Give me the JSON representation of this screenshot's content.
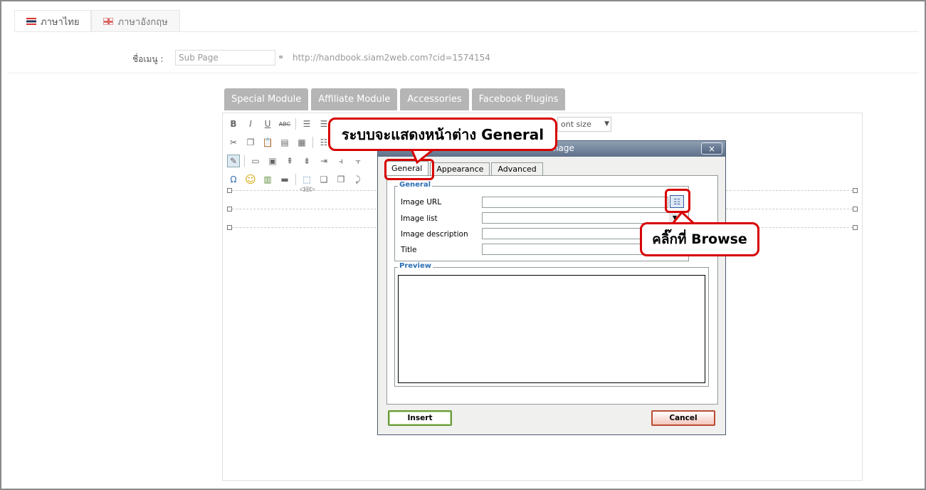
{
  "lang_tabs": [
    {
      "label": "ภาษาไทย",
      "flag": "th"
    },
    {
      "label": "ภาษาอังกฤษ",
      "flag": "uk"
    }
  ],
  "menu": {
    "label": "ชื่อเมนู :",
    "input_value": "Sub Page",
    "url": "http://handbook.siam2web.com?cid=1574154"
  },
  "module_buttons": [
    "Special Module",
    "Affiliate Module",
    "Accessories",
    "Facebook Plugins"
  ],
  "toolbar": {
    "font_size_placeholder": "ont size",
    "row1": [
      "B",
      "I",
      "U",
      "ABC"
    ],
    "row4": [
      "Ω",
      "☺"
    ]
  },
  "dialog": {
    "title": "t image",
    "close_label": "×",
    "tabs": [
      "General",
      "Appearance",
      "Advanced"
    ],
    "general_legend": "General",
    "fields": {
      "image_url": "Image URL",
      "image_list": "Image list",
      "image_description": "Image description",
      "title": "Title"
    },
    "preview_legend": "Preview",
    "insert_label": "Insert",
    "cancel_label": "Cancel"
  },
  "callouts": {
    "general": "ระบบจะแสดงหน้าต่าง General",
    "browse": "คลิ๊กที่ Browse"
  },
  "colors": {
    "callout_border": "#d70000",
    "module_button_bg": "#b5b5b5",
    "dialog_titlebar": "#5d7089",
    "legend": "#2b6fb6"
  }
}
